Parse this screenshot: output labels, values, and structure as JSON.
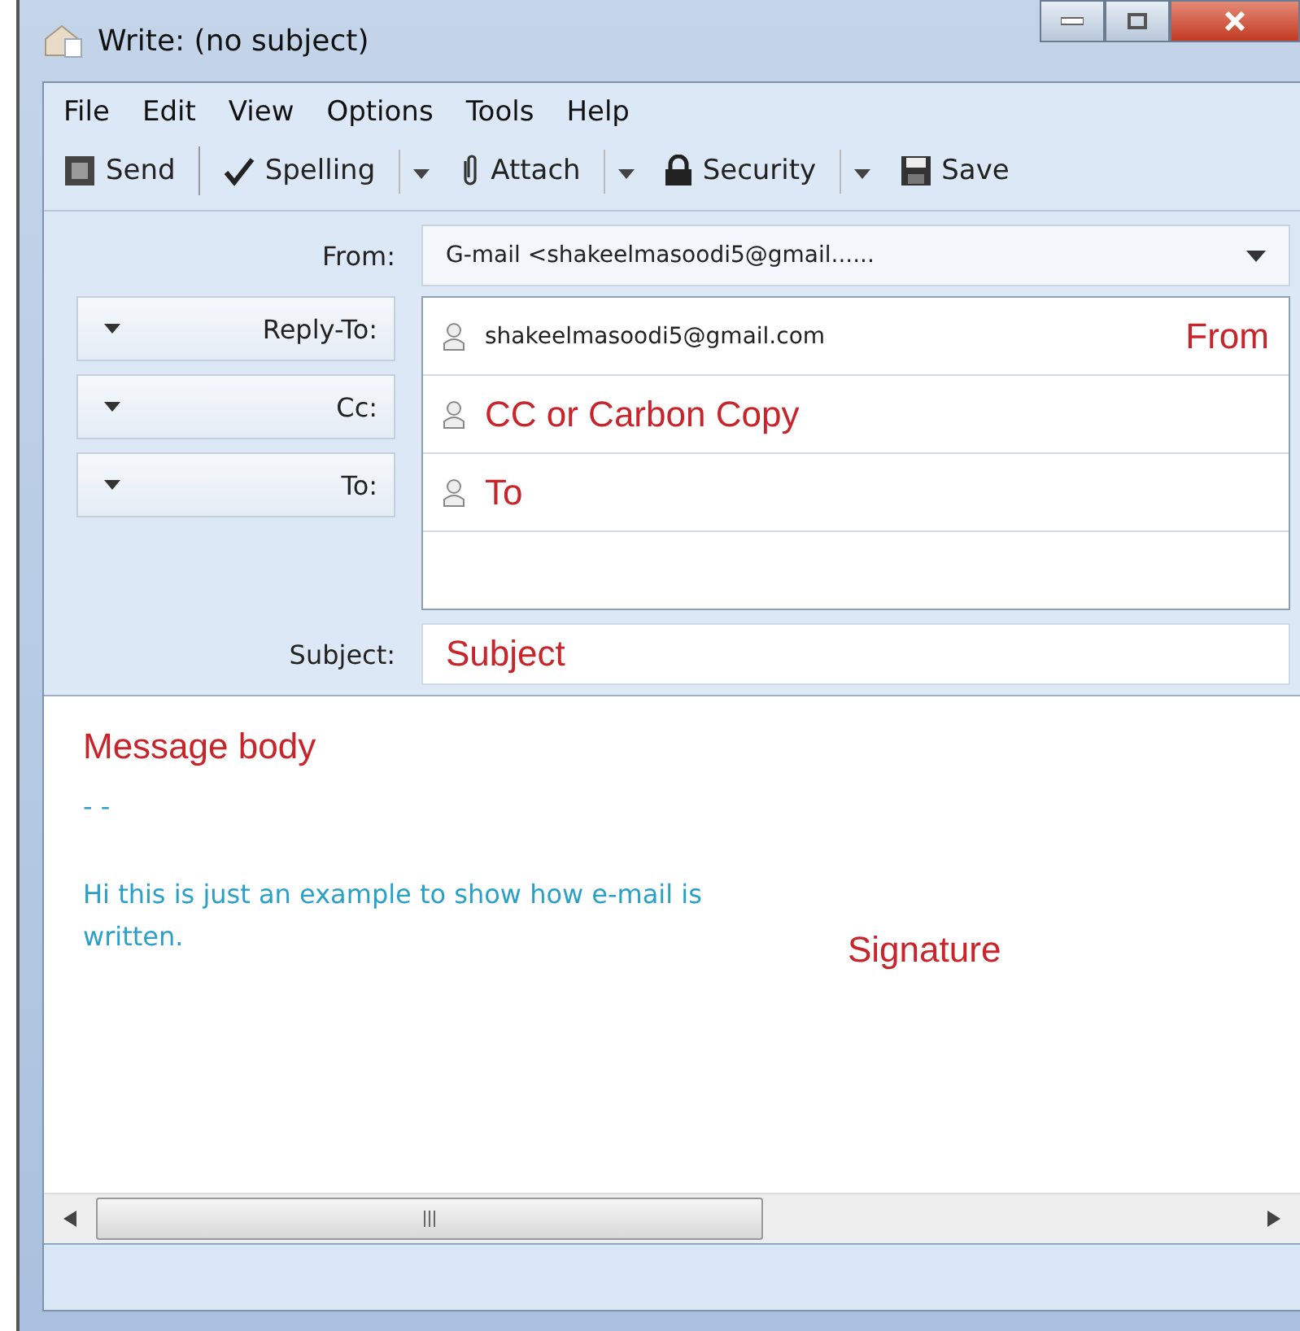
{
  "window": {
    "title": "Write: (no subject)"
  },
  "menu": [
    "File",
    "Edit",
    "View",
    "Options",
    "Tools",
    "Help"
  ],
  "toolbar": [
    {
      "label": "Send",
      "dropdown": false
    },
    {
      "label": "Spelling",
      "dropdown": true
    },
    {
      "label": "Attach",
      "dropdown": true
    },
    {
      "label": "Security",
      "dropdown": true
    },
    {
      "label": "Save",
      "dropdown": false
    }
  ],
  "from": {
    "label": "From:",
    "value": "G-mail <shakeelmasoodi5@gmail......"
  },
  "recipients": [
    {
      "type": "Reply-To:",
      "kind": "address",
      "value": "shakeelmasoodi5@gmail.com",
      "note": "From"
    },
    {
      "type": "Cc:",
      "kind": "annotation",
      "value": "CC or Carbon Copy"
    },
    {
      "type": "To:",
      "kind": "annotation",
      "value": "To"
    }
  ],
  "subject": {
    "label": "Subject:",
    "value": "Subject"
  },
  "body": {
    "annotation": "Message body",
    "separator": "- -",
    "signature": "Hi this is just an example to show how e-mail is written.",
    "signature_note": "Signature"
  }
}
